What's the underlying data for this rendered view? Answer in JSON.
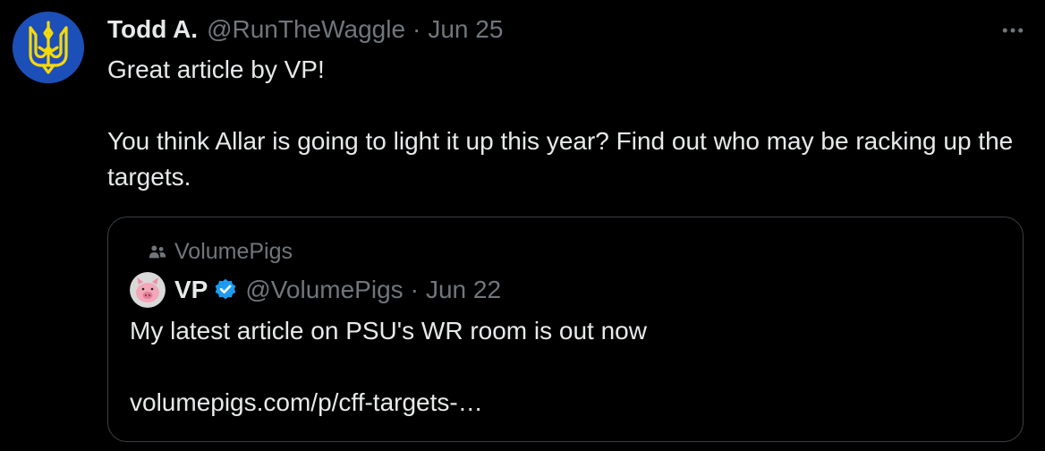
{
  "tweet": {
    "author_name": "Todd A.",
    "author_handle": "@RunTheWaggle",
    "separator": "·",
    "date": "Jun 25",
    "text_line1": "Great article by VP!",
    "text_line2": "You think Allar is going to light it up this year? Find out who may be racking up the targets.",
    "avatar_icon": "ukraine-trident-icon",
    "more_icon": "more-horizontal-icon"
  },
  "quote": {
    "community_icon": "community-icon",
    "community_name": "VolumePigs",
    "author_name": "VP",
    "verified_icon": "verified-badge-icon",
    "author_handle": "@VolumePigs",
    "separator": "·",
    "date": "Jun 22",
    "text_line1": "My latest article on PSU's WR room is out now",
    "link_text": "volumepigs.com/p/cff-targets-…"
  },
  "colors": {
    "background": "#000000",
    "text_primary": "#e7e9ea",
    "text_secondary": "#71767b",
    "border": "#3a3f44",
    "verified_blue": "#1d9bf0",
    "avatar_blue": "#1d4fb8",
    "trident_yellow": "#f5d90a"
  }
}
